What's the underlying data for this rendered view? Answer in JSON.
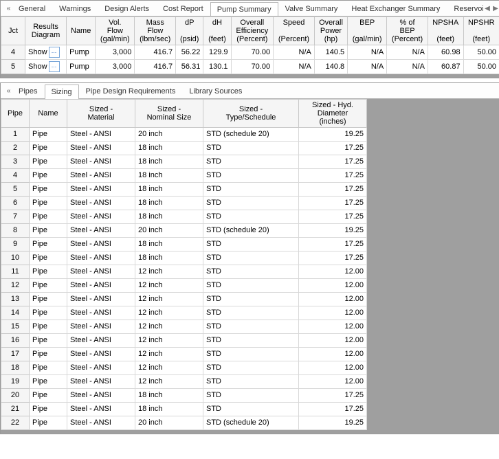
{
  "top_panel": {
    "tabs": [
      "General",
      "Warnings",
      "Design Alerts",
      "Cost Report",
      "Pump Summary",
      "Valve Summary",
      "Heat Exchanger Summary",
      "Reservoir Sur"
    ],
    "active_tab": 4,
    "headers": [
      "Jct",
      "Results\nDiagram",
      "Name",
      "Vol.\nFlow\n(gal/min)",
      "Mass\nFlow\n(lbm/sec)",
      "dP\n\n(psid)",
      "dH\n\n(feet)",
      "Overall\nEfficiency\n(Percent)",
      "Speed\n\n(Percent)",
      "Overall\nPower\n(hp)",
      "BEP\n\n(gal/min)",
      "% of\nBEP\n(Percent)",
      "NPSHA\n\n(feet)",
      "NPSHR\n\n(feet)"
    ],
    "show_label": "Show",
    "show_btn": "...",
    "rows": [
      {
        "jct": "4",
        "name": "Pump",
        "vol": "3,000",
        "mass": "416.7",
        "dp": "56.22",
        "dh": "129.9",
        "oe": "70.00",
        "speed": "N/A",
        "op": "140.5",
        "bep": "N/A",
        "pbep": "N/A",
        "npsha": "60.98",
        "npshr": "50.00"
      },
      {
        "jct": "5",
        "name": "Pump",
        "vol": "3,000",
        "mass": "416.7",
        "dp": "56.31",
        "dh": "130.1",
        "oe": "70.00",
        "speed": "N/A",
        "op": "140.8",
        "bep": "N/A",
        "pbep": "N/A",
        "npsha": "60.87",
        "npshr": "50.00"
      }
    ]
  },
  "bottom_panel": {
    "tabs": [
      "Pipes",
      "Sizing",
      "Pipe Design Requirements",
      "Library Sources"
    ],
    "active_tab": 1,
    "headers": [
      "Pipe",
      "Name",
      "Sized -\nMaterial",
      "Sized -\nNominal Size",
      "Sized -\nType/Schedule",
      "Sized - Hyd.\nDiameter\n(inches)"
    ],
    "rows": [
      {
        "id": "1",
        "name": "Pipe",
        "mat": "Steel - ANSI",
        "nom": "20 inch",
        "sch": "STD (schedule 20)",
        "dia": "19.25"
      },
      {
        "id": "2",
        "name": "Pipe",
        "mat": "Steel - ANSI",
        "nom": "18 inch",
        "sch": "STD",
        "dia": "17.25"
      },
      {
        "id": "3",
        "name": "Pipe",
        "mat": "Steel - ANSI",
        "nom": "18 inch",
        "sch": "STD",
        "dia": "17.25"
      },
      {
        "id": "4",
        "name": "Pipe",
        "mat": "Steel - ANSI",
        "nom": "18 inch",
        "sch": "STD",
        "dia": "17.25"
      },
      {
        "id": "5",
        "name": "Pipe",
        "mat": "Steel - ANSI",
        "nom": "18 inch",
        "sch": "STD",
        "dia": "17.25"
      },
      {
        "id": "6",
        "name": "Pipe",
        "mat": "Steel - ANSI",
        "nom": "18 inch",
        "sch": "STD",
        "dia": "17.25"
      },
      {
        "id": "7",
        "name": "Pipe",
        "mat": "Steel - ANSI",
        "nom": "18 inch",
        "sch": "STD",
        "dia": "17.25"
      },
      {
        "id": "8",
        "name": "Pipe",
        "mat": "Steel - ANSI",
        "nom": "20 inch",
        "sch": "STD (schedule 20)",
        "dia": "19.25"
      },
      {
        "id": "9",
        "name": "Pipe",
        "mat": "Steel - ANSI",
        "nom": "18 inch",
        "sch": "STD",
        "dia": "17.25"
      },
      {
        "id": "10",
        "name": "Pipe",
        "mat": "Steel - ANSI",
        "nom": "18 inch",
        "sch": "STD",
        "dia": "17.25"
      },
      {
        "id": "11",
        "name": "Pipe",
        "mat": "Steel - ANSI",
        "nom": "12 inch",
        "sch": "STD",
        "dia": "12.00"
      },
      {
        "id": "12",
        "name": "Pipe",
        "mat": "Steel - ANSI",
        "nom": "12 inch",
        "sch": "STD",
        "dia": "12.00"
      },
      {
        "id": "13",
        "name": "Pipe",
        "mat": "Steel - ANSI",
        "nom": "12 inch",
        "sch": "STD",
        "dia": "12.00"
      },
      {
        "id": "14",
        "name": "Pipe",
        "mat": "Steel - ANSI",
        "nom": "12 inch",
        "sch": "STD",
        "dia": "12.00"
      },
      {
        "id": "15",
        "name": "Pipe",
        "mat": "Steel - ANSI",
        "nom": "12 inch",
        "sch": "STD",
        "dia": "12.00"
      },
      {
        "id": "16",
        "name": "Pipe",
        "mat": "Steel - ANSI",
        "nom": "12 inch",
        "sch": "STD",
        "dia": "12.00"
      },
      {
        "id": "17",
        "name": "Pipe",
        "mat": "Steel - ANSI",
        "nom": "12 inch",
        "sch": "STD",
        "dia": "12.00"
      },
      {
        "id": "18",
        "name": "Pipe",
        "mat": "Steel - ANSI",
        "nom": "12 inch",
        "sch": "STD",
        "dia": "12.00"
      },
      {
        "id": "19",
        "name": "Pipe",
        "mat": "Steel - ANSI",
        "nom": "12 inch",
        "sch": "STD",
        "dia": "12.00"
      },
      {
        "id": "20",
        "name": "Pipe",
        "mat": "Steel - ANSI",
        "nom": "18 inch",
        "sch": "STD",
        "dia": "17.25"
      },
      {
        "id": "21",
        "name": "Pipe",
        "mat": "Steel - ANSI",
        "nom": "18 inch",
        "sch": "STD",
        "dia": "17.25"
      },
      {
        "id": "22",
        "name": "Pipe",
        "mat": "Steel - ANSI",
        "nom": "20 inch",
        "sch": "STD (schedule 20)",
        "dia": "19.25"
      }
    ]
  }
}
